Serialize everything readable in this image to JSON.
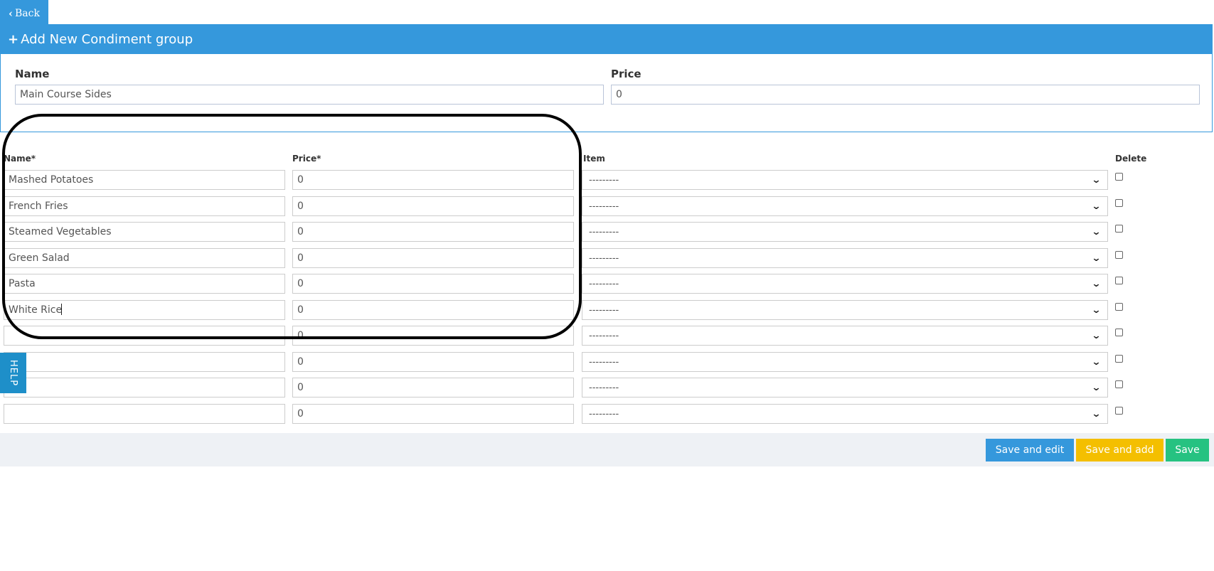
{
  "nav": {
    "back_label": "Back"
  },
  "panel": {
    "title": "Add New Condiment group",
    "name_label": "Name",
    "name_value": "Main Course Sides",
    "price_label": "Price",
    "price_value": "0"
  },
  "table": {
    "headers": {
      "name": "Name*",
      "price": "Price*",
      "item": "Item",
      "delete": "Delete"
    },
    "rows": [
      {
        "name": "Mashed Potatoes",
        "price": "0",
        "item": "---------"
      },
      {
        "name": "French Fries",
        "price": "0",
        "item": "---------"
      },
      {
        "name": "Steamed Vegetables",
        "price": "0",
        "item": "---------"
      },
      {
        "name": "Green Salad",
        "price": "0",
        "item": "---------"
      },
      {
        "name": "Pasta",
        "price": "0",
        "item": "---------"
      },
      {
        "name": "White Rice",
        "price": "0",
        "item": "---------"
      },
      {
        "name": "",
        "price": "0",
        "item": "---------"
      },
      {
        "name": "",
        "price": "0",
        "item": "---------"
      },
      {
        "name": "",
        "price": "0",
        "item": "---------"
      },
      {
        "name": "",
        "price": "0",
        "item": "---------"
      }
    ]
  },
  "help_label": "HELP",
  "actions": {
    "save_and_edit": "Save and edit",
    "save_and_add": "Save and add",
    "save": "Save"
  },
  "colors": {
    "primary": "#3598dc",
    "warning": "#f4bf00",
    "success": "#26c281",
    "help": "#1e8fc9",
    "footer_bg": "#eef1f5"
  }
}
